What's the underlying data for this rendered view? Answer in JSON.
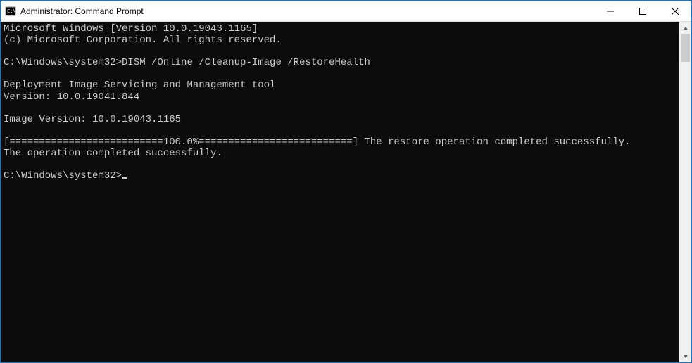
{
  "titlebar": {
    "title": "Administrator: Command Prompt"
  },
  "terminal": {
    "lines": [
      "Microsoft Windows [Version 10.0.19043.1165]",
      "(c) Microsoft Corporation. All rights reserved.",
      "",
      "C:\\Windows\\system32>DISM /Online /Cleanup-Image /RestoreHealth",
      "",
      "Deployment Image Servicing and Management tool",
      "Version: 10.0.19041.844",
      "",
      "Image Version: 10.0.19043.1165",
      "",
      "[==========================100.0%==========================] The restore operation completed successfully.",
      "The operation completed successfully.",
      ""
    ],
    "prompt": "C:\\Windows\\system32>"
  }
}
